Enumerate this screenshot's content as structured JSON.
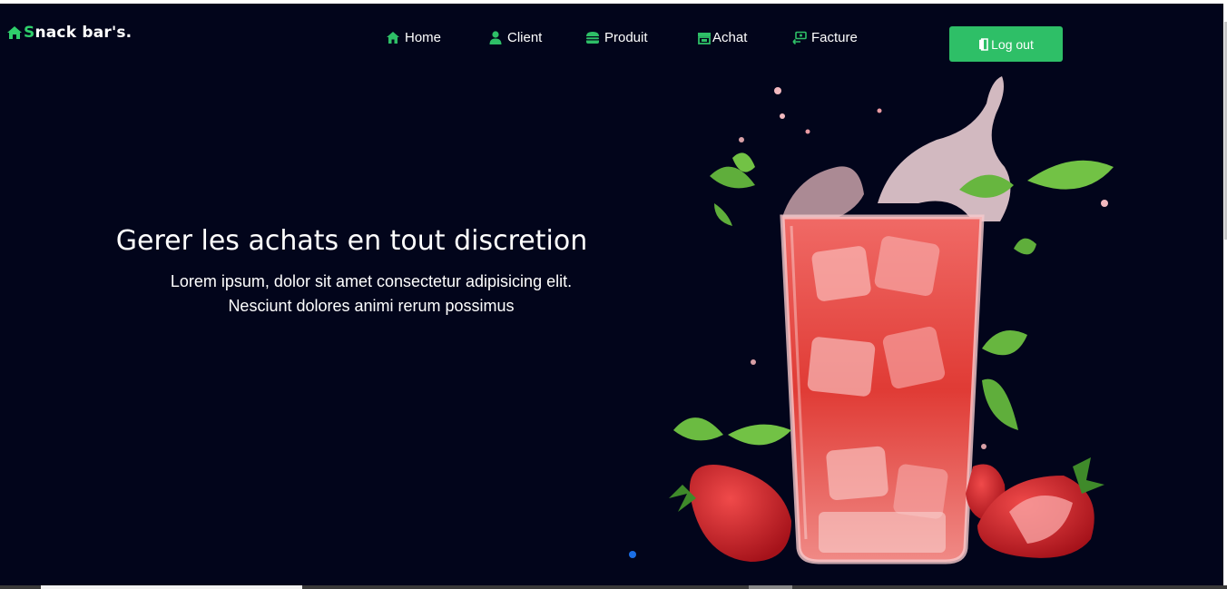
{
  "brand": {
    "first_letter": "S",
    "rest": "nack bar's."
  },
  "nav": {
    "items": [
      {
        "id": "home",
        "label": "Home",
        "icon": "home-icon"
      },
      {
        "id": "client",
        "label": "Client",
        "icon": "user-icon"
      },
      {
        "id": "produit",
        "label": "Produit",
        "icon": "burger-icon"
      },
      {
        "id": "achat",
        "label": "Achat",
        "icon": "store-icon"
      },
      {
        "id": "facture",
        "label": "Facture",
        "icon": "money-bill-transfer-icon"
      }
    ],
    "logout_label": "Log out",
    "logout_icon": "door-exit-icon"
  },
  "hero": {
    "title": "Gerer les achats en tout discretion",
    "subtitle_line1": "Lorem ipsum, dolor sit amet consectetur adipisicing elit.",
    "subtitle_line2": "Nesciunt dolores animi rerum possimus",
    "image_alt": "strawberry drink with ice, mint and strawberries"
  },
  "carousel": {
    "active_index": 0,
    "count": 1
  },
  "colors": {
    "background": "#02051b",
    "accent": "#2ebf67",
    "text": "#ffffff",
    "dot": "#1b6fe6"
  }
}
